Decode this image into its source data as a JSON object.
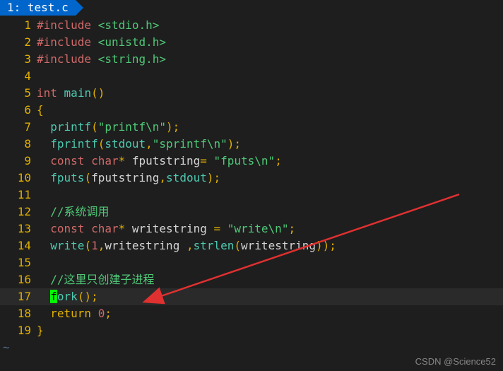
{
  "tab": {
    "index": "1",
    "filename": "test.c"
  },
  "gutter": [
    "1",
    "2",
    "3",
    "4",
    "5",
    "6",
    "7",
    "8",
    "9",
    "10",
    "11",
    "12",
    "13",
    "14",
    "15",
    "16",
    "17",
    "18",
    "19"
  ],
  "code": {
    "l1": {
      "inc": "#include",
      "hdr": "<stdio.h>"
    },
    "l2": {
      "inc": "#include",
      "hdr": "<unistd.h>"
    },
    "l3": {
      "inc": "#include",
      "hdr": "<string.h>"
    },
    "l5": {
      "type": "int",
      "name": "main",
      "paren": "()"
    },
    "l6": {
      "brace": "{"
    },
    "l7": {
      "fn": "printf",
      "open": "(",
      "str": "\"printf\\n\"",
      "close": ");"
    },
    "l8": {
      "fn": "fprintf",
      "open": "(",
      "arg1": "stdout",
      "comma": ",",
      "str": "\"sprintf\\n\"",
      "close": ");"
    },
    "l9": {
      "const": "const",
      "type": "char",
      "star": "*",
      "name": " fputstring",
      "eq": "= ",
      "str": "\"fputs\\n\"",
      "semi": ";"
    },
    "l10": {
      "fn": "fputs",
      "open": "(",
      "arg1": "fputstring",
      "comma": ",",
      "arg2": "stdout",
      "close": ");"
    },
    "l12": {
      "cmt": "//系统调用"
    },
    "l13": {
      "const": "const",
      "type": "char",
      "star": "*",
      "name": " writestring ",
      "eq": "= ",
      "str": "\"write\\n\"",
      "semi": ";"
    },
    "l14": {
      "fn": "write",
      "open": "(",
      "arg1": "1",
      "c1": ",",
      "arg2": "writestring ",
      "c2": ",",
      "fn2": "strlen",
      "open2": "(",
      "arg3": "writestring",
      "close2": ")",
      "close": ");"
    },
    "l16": {
      "cmt": "//这里只创建子进程"
    },
    "l17": {
      "f": "f",
      "ork": "ork",
      "paren": "();"
    },
    "l18": {
      "ret": "return",
      "val": "0",
      "semi": ";"
    },
    "l19": {
      "brace": "}"
    }
  },
  "watermark": "CSDN @Science52"
}
